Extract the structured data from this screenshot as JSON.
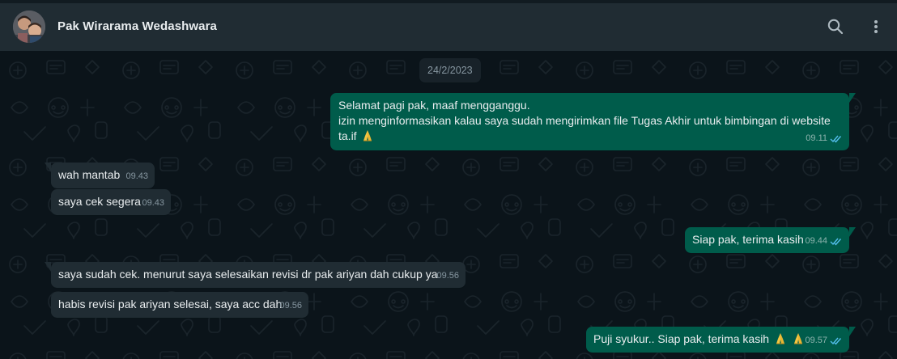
{
  "contact": {
    "name": "Pak Wirarama Wedashwara",
    "avatar_icon": "profile-photo"
  },
  "header": {
    "search_icon": "search-icon",
    "menu_icon": "kebab-menu-icon"
  },
  "chat": {
    "date": "24/2/2023",
    "messages": [
      {
        "direction": "out",
        "lines": [
          "Selamat pagi pak, maaf mengganggu.",
          "izin menginformasikan kalau saya sudah mengirimkan file Tugas Akhir untuk bimbingan di website",
          "ta.if"
        ],
        "emoji": "🙏",
        "time": "09.11",
        "status": "read"
      },
      {
        "direction": "in",
        "text": "wah mantab",
        "time": "09.43"
      },
      {
        "direction": "in",
        "text": "saya cek segera",
        "time": "09.43"
      },
      {
        "direction": "out",
        "text": "Siap pak, terima kasih",
        "time": "09.44",
        "status": "read"
      },
      {
        "direction": "in",
        "text": "saya sudah cek. menurut saya selesaikan revisi dr pak ariyan dah cukup ya",
        "time": "09.56"
      },
      {
        "direction": "in",
        "text": "habis revisi pak ariyan selesai, saya acc dah",
        "time": "09.56"
      },
      {
        "direction": "out",
        "text": "Puji syukur.. Siap pak, terima kasih",
        "emoji": "🙏🙏",
        "time": "09.57",
        "status": "read"
      }
    ]
  },
  "colors": {
    "header_bg": "#202c33",
    "chat_bg": "#0b141a",
    "outgoing_bubble": "#005c4b",
    "incoming_bubble": "#202c33",
    "read_ticks": "#53bdeb",
    "text": "#e9edef",
    "meta_text": "#8696a0"
  }
}
